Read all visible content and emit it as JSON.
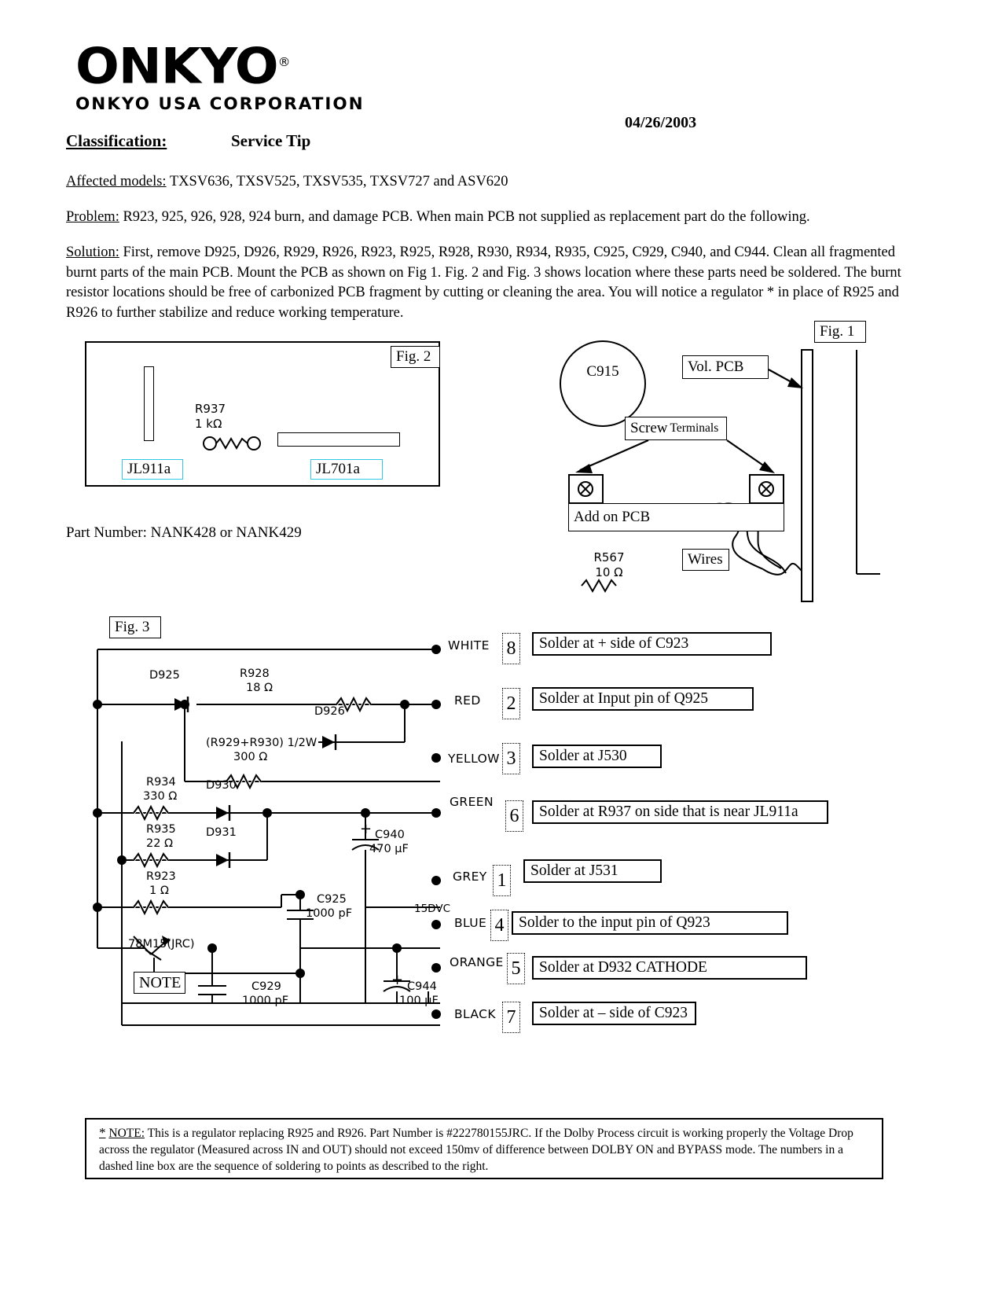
{
  "header": {
    "logo_word": "ONKYO",
    "logo_registered": "®",
    "logo_subtitle": "ONKYO USA CORPORATION",
    "date": "04/26/2003",
    "classification_label": "Classification:",
    "classification_value": "Service Tip"
  },
  "body": {
    "affected_label": "Affected models:",
    "affected_text": " TXSV636, TXSV525, TXSV535, TXSV727 and ASV620",
    "problem_label": "Problem:",
    "problem_text": " R923, 925, 926, 928, 924 burn, and damage PCB. When main PCB not supplied as replacement part do the following.",
    "solution_label": "Solution:",
    "solution_text": " First, remove D925, D926, R929, R926, R923, R925, R928, R930, R934, R935, C925, C929, C940, and C944. Clean all fragmented burnt parts of the main PCB. Mount the PCB as shown on Fig 1.  Fig. 2 and Fig. 3 shows location where these parts need be soldered.  The burnt resistor locations should be free of carbonized PCB fragment by cutting or cleaning the area.  You will notice a regulator * in place of R925 and R926 to further stabilize and reduce working temperature.",
    "part_number": "Part Number: NANK428 or NANK429"
  },
  "fig2": {
    "tag": "Fig. 2",
    "resistor_name": "R937",
    "resistor_value": "1 kΩ",
    "connector_left": "JL911a",
    "connector_right": "JL701a",
    "connector_border_color": "#31c8e8"
  },
  "fig1": {
    "tag": "Fig. 1",
    "cap_label": "C915",
    "vol_pcb": "Vol.  PCB",
    "screw_terminals_main": "Screw",
    "screw_terminals_sub": "Terminals",
    "add_on_pcb": "Add on PCB",
    "wires": "Wires",
    "resistor_name": "R567",
    "resistor_value": "10 Ω"
  },
  "fig3": {
    "tag": "Fig. 3",
    "note_tag": "NOTE",
    "voltage_tag": "15DVC",
    "components": [
      {
        "name": "D925",
        "value": ""
      },
      {
        "name": "R928",
        "value": "18 Ω"
      },
      {
        "name": "D926",
        "value": ""
      },
      {
        "name": "(R929+R930) 1/2W",
        "value": "300 Ω"
      },
      {
        "name": "R934",
        "value": "330 Ω"
      },
      {
        "name": "D930",
        "value": ""
      },
      {
        "name": "R935",
        "value": "22 Ω"
      },
      {
        "name": "D931",
        "value": ""
      },
      {
        "name": "R923",
        "value": "1 Ω"
      },
      {
        "name": "C940",
        "value": "470 µF"
      },
      {
        "name": "C925",
        "value": "1000 pF"
      },
      {
        "name": "78M15(JRC)",
        "value": ""
      },
      {
        "name": "C929",
        "value": "1000 pF"
      },
      {
        "name": "C944",
        "value": "100 µF"
      }
    ],
    "wires": [
      {
        "color": "WHITE",
        "seq": "8",
        "instruction": "Solder at + side of C923"
      },
      {
        "color": "RED",
        "seq": "2",
        "instruction": "Solder at Input pin of Q925"
      },
      {
        "color": "YELLOW",
        "seq": "3",
        "instruction": "Solder at J530"
      },
      {
        "color": "GREEN",
        "seq": "6",
        "instruction": "Solder at R937 on side that is near JL911a"
      },
      {
        "color": "GREY",
        "seq": "1",
        "instruction": "Solder at J531"
      },
      {
        "color": "BLUE",
        "seq": "4",
        "instruction": "Solder to the input pin of Q923"
      },
      {
        "color": "ORANGE",
        "seq": "5",
        "instruction": "Solder at D932 CATHODE"
      },
      {
        "color": "BLACK",
        "seq": "7",
        "instruction": "Solder at – side of C923"
      }
    ]
  },
  "footnote": {
    "star": "*",
    "label": "NOTE:",
    "text": " This is a regulator replacing R925 and R926. Part Number is #222780155JRC. If the Dolby Process circuit is working properly the Voltage Drop across the regulator (Measured across IN and OUT) should not exceed 150mv of difference between DOLBY ON and BYPASS mode.  The numbers in a dashed line box are the sequence of soldering to points as described to the right."
  }
}
